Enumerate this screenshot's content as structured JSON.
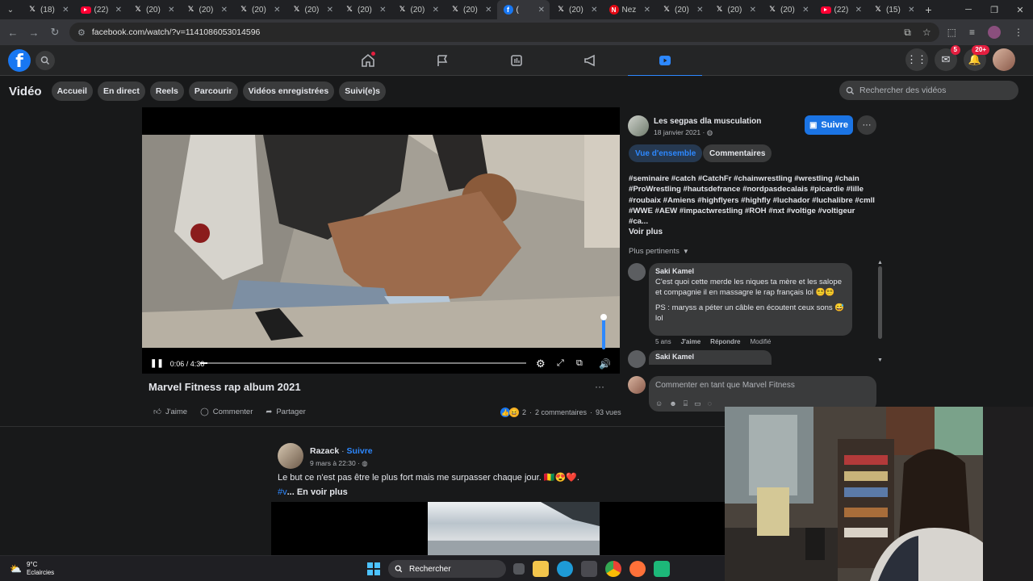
{
  "browser": {
    "tabs": [
      {
        "icon": "x-icon",
        "label": "(18)"
      },
      {
        "icon": "youtube-icon",
        "label": "(22)"
      },
      {
        "icon": "x-icon",
        "label": "(20)"
      },
      {
        "icon": "x-icon",
        "label": "(20)"
      },
      {
        "icon": "x-icon",
        "label": "(20)"
      },
      {
        "icon": "x-icon",
        "label": "(20)"
      },
      {
        "icon": "x-icon",
        "label": "(20)"
      },
      {
        "icon": "x-icon",
        "label": "(20)"
      },
      {
        "icon": "x-icon",
        "label": "(20)"
      },
      {
        "icon": "facebook-icon",
        "label": "(",
        "active": true
      },
      {
        "icon": "x-icon",
        "label": "(20)"
      },
      {
        "icon": "netflix-icon",
        "label": "Nez"
      },
      {
        "icon": "x-icon",
        "label": "(20)"
      },
      {
        "icon": "x-icon",
        "label": "(20)"
      },
      {
        "icon": "x-icon",
        "label": "(20)"
      },
      {
        "icon": "youtube-icon",
        "label": "(22)"
      },
      {
        "icon": "x-icon",
        "label": "(15)"
      }
    ],
    "url": "facebook.com/watch/?v=1141086053014596"
  },
  "fb": {
    "notifications_badge": "20+",
    "messenger_badge": "5"
  },
  "video_nav": {
    "title": "Vidéo",
    "chips": [
      "Accueil",
      "En direct",
      "Reels",
      "Parcourir",
      "Vidéos enregistrées",
      "Suivi(e)s"
    ],
    "search_placeholder": "Rechercher des vidéos"
  },
  "player": {
    "time": "0:06 / 4:36",
    "progress": 0.022,
    "volume": 1.0
  },
  "video": {
    "title": "Marvel Fitness rap album 2021",
    "actions": {
      "like": "J'aime",
      "comment": "Commenter",
      "share": "Partager"
    },
    "reactions_count": "2",
    "comments_count": "2 commentaires",
    "views": "93 vues"
  },
  "page": {
    "name": "Les segpas dla musculation",
    "date": "18 janvier 2021 ·",
    "follow_label": "Suivre",
    "tabs": [
      "Vue d'ensemble",
      "Commentaires"
    ],
    "hashtags_lines": [
      "#seminaire #catch #CatchFr #chainwrestling #wrestling #chain",
      "#ProWrestling #hautsdefrance #nordpasdecalais #picardie #lille",
      "#roubaix #Amiens #highflyers #highfly #luchador #luchalibre #cmll",
      "#WWE #AEW #impactwrestling #ROH #nxt #voltige #voltigeur",
      "#ca..."
    ],
    "see_more": "Voir plus",
    "sort_label": "Plus pertinents"
  },
  "comment": {
    "author": "Saki Kamel",
    "text1": "C'est quoi cette merde les niques ta mère et les salope et compagnie il en massagre le rap français lol 😵‍💫😵‍💫",
    "text2": "PS : maryss a péter un câble en écoutent ceux sons 😅 lol",
    "time": "5 ans",
    "like": "J'aime",
    "reply": "Répondre",
    "edited": "Modifié",
    "author2": "Saki Kamel",
    "compose_placeholder": "Commenter en tant que Marvel Fitness"
  },
  "post2": {
    "author": "Razack",
    "follow": "Suivre",
    "date": "9 mars à 22:30 ·",
    "text": "Le but ce n'est pas être le plus fort mais me surpasser chaque jour. 🇬🇳😍❤️.",
    "hashtag": "#v",
    "more": "... En voir plus"
  },
  "taskbar": {
    "temp": "9°C",
    "weather": "Eclaircies",
    "search": "Rechercher"
  }
}
